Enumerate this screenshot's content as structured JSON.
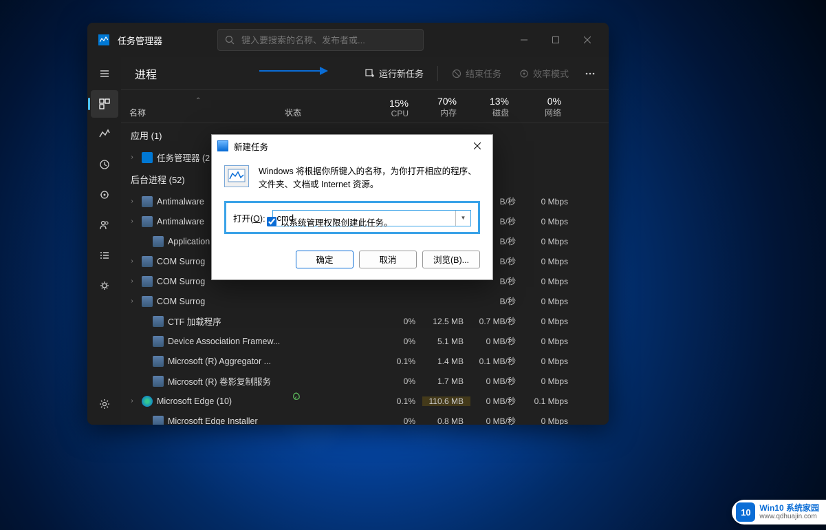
{
  "window": {
    "title": "任务管理器",
    "search_placeholder": "键入要搜索的名称、发布者或..."
  },
  "toolbar": {
    "section_title": "进程",
    "run_task": "运行新任务",
    "end_task": "结束任务",
    "efficiency_mode": "效率模式"
  },
  "columns": {
    "name": "名称",
    "status": "状态",
    "cpu_pct": "15%",
    "cpu_lbl": "CPU",
    "mem_pct": "70%",
    "mem_lbl": "内存",
    "disk_pct": "13%",
    "disk_lbl": "磁盘",
    "net_pct": "0%",
    "net_lbl": "网络"
  },
  "groups": {
    "apps": "应用 (1)",
    "bg": "后台进程 (52)"
  },
  "rows": [
    {
      "exp": "›",
      "icon": "tm",
      "name": "任务管理器 (2",
      "partial": true
    },
    {
      "exp": "›",
      "icon": "svc",
      "name": "Antimalware",
      "disk": "B/秒",
      "net": "0 Mbps"
    },
    {
      "exp": "›",
      "icon": "svc",
      "name": "Antimalware",
      "disk": "B/秒",
      "net": "0 Mbps"
    },
    {
      "exp": "",
      "icon": "svc",
      "name": "Application F",
      "disk": "B/秒",
      "net": "0 Mbps",
      "indent": true
    },
    {
      "exp": "›",
      "icon": "svc",
      "name": "COM Surrog",
      "disk": "B/秒",
      "net": "0 Mbps"
    },
    {
      "exp": "›",
      "icon": "svc",
      "name": "COM Surrog",
      "disk": "B/秒",
      "net": "0 Mbps"
    },
    {
      "exp": "›",
      "icon": "svc",
      "name": "COM Surrog",
      "disk": "B/秒",
      "net": "0 Mbps"
    },
    {
      "exp": "",
      "icon": "svc",
      "name": "CTF 加载程序",
      "cpu": "0%",
      "mem": "12.5 MB",
      "disk": "0.7 MB/秒",
      "net": "0 Mbps",
      "indent": true
    },
    {
      "exp": "",
      "icon": "svc",
      "name": "Device Association Framew...",
      "cpu": "0%",
      "mem": "5.1 MB",
      "disk": "0 MB/秒",
      "net": "0 Mbps",
      "indent": true
    },
    {
      "exp": "",
      "icon": "svc",
      "name": "Microsoft (R) Aggregator ...",
      "cpu": "0.1%",
      "mem": "1.4 MB",
      "disk": "0.1 MB/秒",
      "net": "0 Mbps",
      "indent": true
    },
    {
      "exp": "",
      "icon": "svc",
      "name": "Microsoft (R) 卷影复制服务",
      "cpu": "0%",
      "mem": "1.7 MB",
      "disk": "0 MB/秒",
      "net": "0 Mbps",
      "indent": true
    },
    {
      "exp": "›",
      "icon": "edge",
      "name": "Microsoft Edge (10)",
      "cpu": "0.1%",
      "mem": "110.6 MB",
      "disk": "0 MB/秒",
      "net": "0.1 Mbps",
      "leaf": true,
      "heat": true
    },
    {
      "exp": "",
      "icon": "svc",
      "name": "Microsoft Edge Installer",
      "cpu": "0%",
      "mem": "0.8 MB",
      "disk": "0 MB/秒",
      "net": "0 Mbps",
      "indent": true
    }
  ],
  "dialog": {
    "title": "新建任务",
    "message_l1": "Windows 将根据你所键入的名称，为你打开相应的程序、",
    "message_l2": "文件夹、文档或 Internet 资源。",
    "open_label_pre": "打开(",
    "open_label_u": "O",
    "open_label_post": "):",
    "value": "cmd",
    "admin_label": "以系统管理权限创建此任务。",
    "btn_ok": "确定",
    "btn_cancel": "取消",
    "btn_browse": "浏览(B)..."
  },
  "watermark": {
    "icon_text": "10",
    "title": "Win10 系统家园",
    "url": "www.qdhuajin.com"
  }
}
